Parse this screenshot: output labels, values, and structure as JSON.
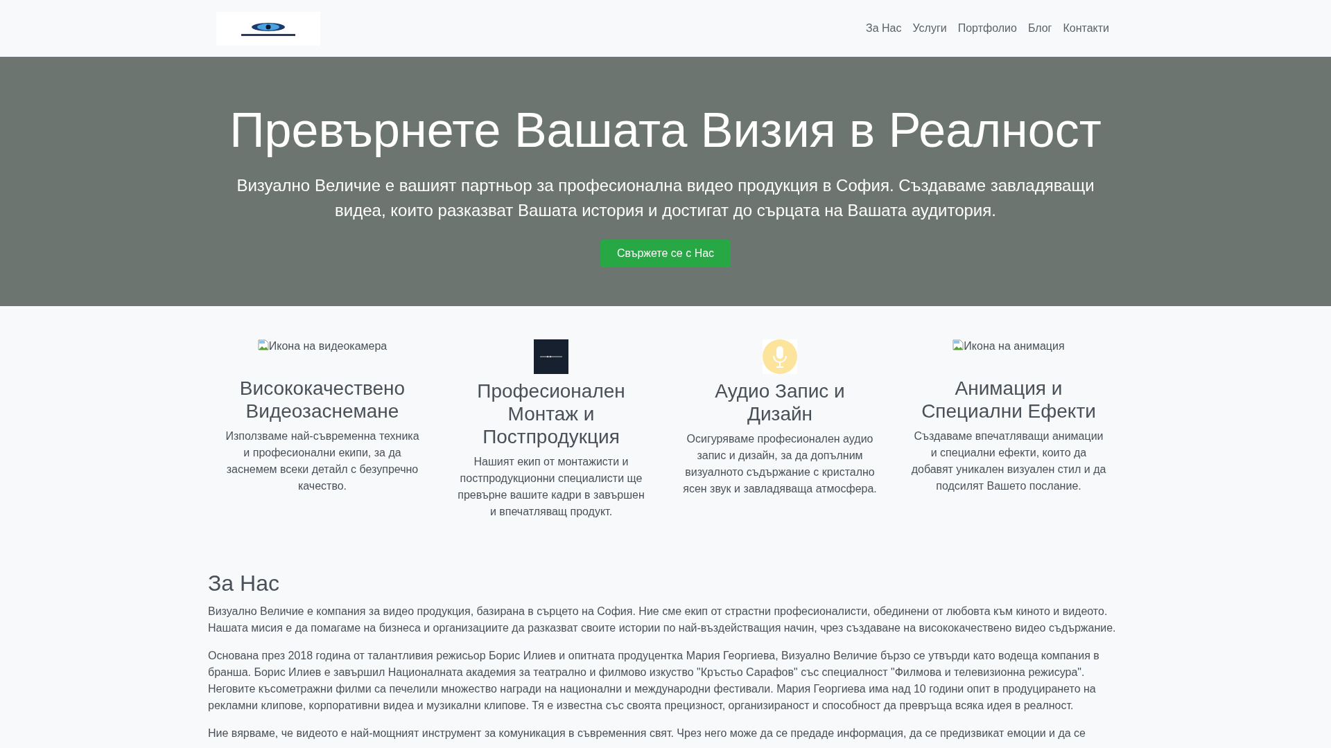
{
  "navbar": {
    "links": [
      {
        "label": "За Нас"
      },
      {
        "label": "Услуги"
      },
      {
        "label": "Портфолио"
      },
      {
        "label": "Блог"
      },
      {
        "label": "Контакти"
      }
    ]
  },
  "hero": {
    "title": "Превърнете Вашата Визия в Реалност",
    "lead": "Визуално Величие е вашият партньор за професионална видео продукция в София. Създаваме завладяващи видеа, които разказват Вашата история и достигат до сърцата на Вашата аудитория.",
    "button": "Свържете се с Нас"
  },
  "features": [
    {
      "icon": {
        "kind": "broken",
        "alt": "Икона на видеокамера"
      },
      "title": "Висококачествено Видеозаснемане",
      "text": "Използваме най-съвременна техника и професионални екипи, за да заснемем всеки детайл с безупречно качество."
    },
    {
      "icon": {
        "kind": "timeline"
      },
      "title": "Професионален Монтаж и Постпродукция",
      "text": "Нашият екип от монтажисти и постпродукционни специалисти ще превърне вашите кадри в завършен и впечатляващ продукт."
    },
    {
      "icon": {
        "kind": "microphone"
      },
      "title": "Аудио Запис и Дизайн",
      "text": "Осигуряваме професионален аудио запис и дизайн, за да допълним визуалното съдържание с кристално ясен звук и завладяваща атмосфера."
    },
    {
      "icon": {
        "kind": "broken",
        "alt": "Икона на анимация"
      },
      "title": "Анимация и Специални Ефекти",
      "text": "Създаваме впечатляващи анимации и специални ефекти, които да добавят уникален визуален стил и да подсилят Вашето послание."
    }
  ],
  "about": {
    "title": "За Нас",
    "paragraphs": [
      "Визуално Величие е компания за видео продукция, базирана в сърцето на София. Ние сме екип от страстни професионалисти, обединени от любовта към киното и видеото. Нашата мисия е да помагаме на бизнеса и организациите да разказват своите истории по най-въздействащия начин, чрез създаване на висококачествено видео съдържание.",
      "Основана през 2018 година от талантливия режисьор Борис Илиев и опитната продуцентка Мария Георгиева, Визуално Величие бързо се утвърди като водеща компания в бранша. Борис Илиев е завършил Националната академия за театрално и филмово изкуство \"Кръстьо Сарафов\" със специалност \"Филмова и телевизионна режисура\". Неговите късометражни филми са печелили множество награди на национални и международни фестивали. Мария Георгиева има над 10 години опит в продуцирането на рекламни клипове, корпоративни видеа и музикални клипове. Тя е известна със своята прецизност, организираност и способност да превръща всяка идея в реалност.",
      "Ние вярваме, че видеото е най-мощният инструмент за комуникация в съвременния свят. Чрез него може да се предаде информация, да се предизвикат емоции и да се"
    ]
  }
}
